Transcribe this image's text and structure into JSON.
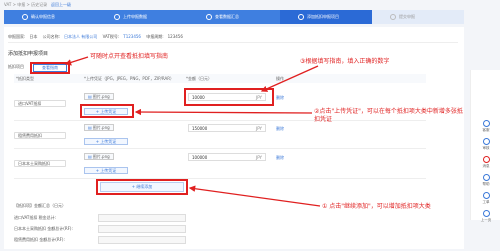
{
  "breadcrumb": [
    "VAT",
    "申报",
    "历史记录",
    "返回上一级"
  ],
  "steps": [
    {
      "label": "确认申报信息",
      "state": "done"
    },
    {
      "label": "上传申报数据",
      "state": "done"
    },
    {
      "label": "查看数据汇总",
      "state": "done"
    },
    {
      "label": "添加抵扣申报项目",
      "state": "active"
    },
    {
      "label": "提交申报",
      "state": "todo"
    }
  ],
  "info": {
    "country_label": "申报国家:",
    "country_value": "日本",
    "company_label": "公司名称:",
    "company_value": "日本法人 有限公司",
    "vat_label": "VAT税号:",
    "vat_value": "T123456",
    "period_label": "申报周期:",
    "period_value": "123456"
  },
  "section_title": "添加抵扣申报项目",
  "deduction_label": "抵扣项目",
  "guide_button": "查看指南",
  "table_headers": {
    "type": "*抵扣类型",
    "proof": "*上传凭证（JPG，JPEG，PNG，PDF，ZIP/RAR）",
    "amount": "*金额（日元）",
    "op": "操作"
  },
  "rows": [
    {
      "type": "进口VAT抵扣",
      "file": "图片.png",
      "upload_label": "+ 上传凭证",
      "amount": "10000",
      "unit": "JPY",
      "op": "删除"
    },
    {
      "type": "租赁费用抵扣",
      "file": "图片.png",
      "upload_label": "+ 上传凭证",
      "amount": "150000",
      "unit": "JPY",
      "op": "删除"
    },
    {
      "type": "日本本土采购抵扣",
      "file": "图片.png",
      "upload_label": "+ 上传凭证",
      "amount": "100000",
      "unit": "JPY",
      "op": "删除"
    }
  ],
  "add_button": "+ 继续添加",
  "summary": {
    "title": "【抵扣项】金额汇总（日元）",
    "rows": [
      {
        "label": "进口VAT抵扣 税金总计:"
      },
      {
        "label": "日本本土采购抵扣 金额总计(RF):"
      },
      {
        "label": "租赁费用抵扣 金额总计(RF):"
      }
    ]
  },
  "annotations": {
    "a1": "可随时点开查看抵扣填写指南",
    "a2": "③根据填写指南，填入正确的数字",
    "a3": "②点击\"上传凭证\"，可以在每个抵扣项大类中新增多张抵扣凭证",
    "a4": "① 点击\"继续添加\"，可以增加抵扣项大类"
  },
  "sidebar": [
    "客服",
    "审核",
    "消息",
    "帮助",
    "工单",
    "上一页"
  ],
  "colors": {
    "accent": "#2b6ad6",
    "annotation": "#e02020"
  }
}
